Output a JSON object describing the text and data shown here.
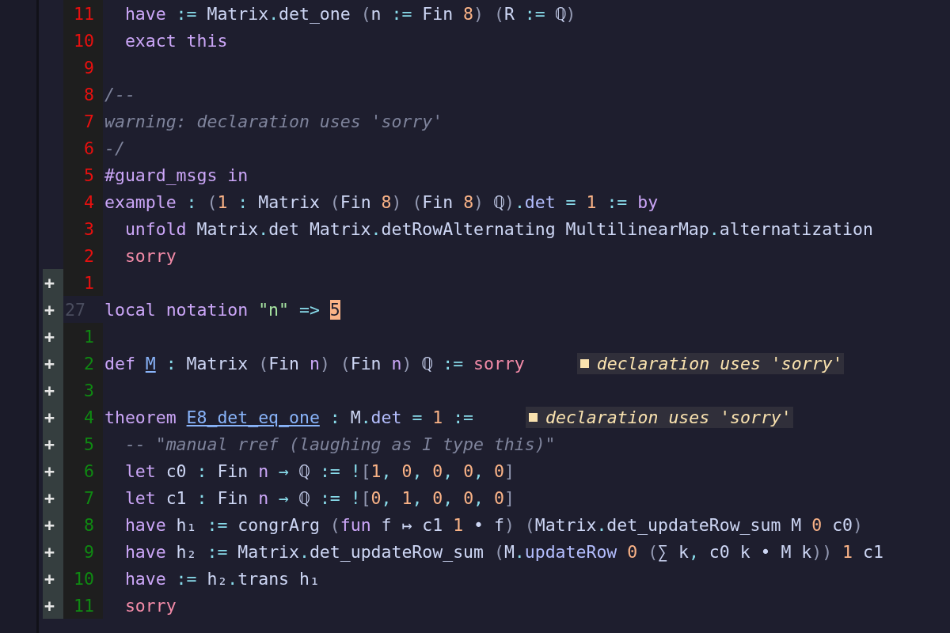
{
  "editor": {
    "lines": [
      {
        "number": "11",
        "kind": "above",
        "tokens": [
          {
            "text": "  have ",
            "kind": "kw"
          },
          {
            "text": ":= ",
            "kind": "op"
          },
          {
            "text": "Matrix",
            "kind": "id"
          },
          {
            "text": ".",
            "kind": "op"
          },
          {
            "text": "det_one ",
            "kind": "id"
          },
          {
            "text": "(",
            "kind": "paren"
          },
          {
            "text": "n ",
            "kind": "id"
          },
          {
            "text": ":= ",
            "kind": "op"
          },
          {
            "text": "Fin ",
            "kind": "id"
          },
          {
            "text": "8",
            "kind": "num"
          },
          {
            "text": ") (",
            "kind": "paren"
          },
          {
            "text": "R ",
            "kind": "id"
          },
          {
            "text": ":= ",
            "kind": "op"
          },
          {
            "text": "ℚ",
            "kind": "id"
          },
          {
            "text": ")",
            "kind": "paren"
          }
        ]
      },
      {
        "number": "10",
        "kind": "above",
        "tokens": [
          {
            "text": "  exact this",
            "kind": "kw"
          }
        ]
      },
      {
        "number": "9",
        "kind": "above"
      },
      {
        "number": "8",
        "kind": "above",
        "tokens": [
          {
            "text": "/--",
            "kind": "comment"
          }
        ]
      },
      {
        "number": "7",
        "kind": "above",
        "tokens": [
          {
            "text": "warning: declaration uses 'sorry'",
            "kind": "comment"
          }
        ]
      },
      {
        "number": "6",
        "kind": "above",
        "tokens": [
          {
            "text": "-/",
            "kind": "comment"
          }
        ]
      },
      {
        "number": "5",
        "kind": "above",
        "tokens": [
          {
            "text": "#guard_msgs in",
            "kind": "kw"
          }
        ]
      },
      {
        "number": "4",
        "kind": "above",
        "tokens": [
          {
            "text": "example",
            "kind": "kw"
          },
          {
            "text": " : ",
            "kind": "op"
          },
          {
            "text": "(",
            "kind": "paren"
          },
          {
            "text": "1",
            "kind": "num"
          },
          {
            "text": " : ",
            "kind": "op"
          },
          {
            "text": "Matrix ",
            "kind": "id"
          },
          {
            "text": "(",
            "kind": "paren"
          },
          {
            "text": "Fin ",
            "kind": "id"
          },
          {
            "text": "8",
            "kind": "num"
          },
          {
            "text": ") (",
            "kind": "paren"
          },
          {
            "text": "Fin ",
            "kind": "id"
          },
          {
            "text": "8",
            "kind": "num"
          },
          {
            "text": ")",
            "kind": "paren"
          },
          {
            "text": " ℚ",
            "kind": "id"
          },
          {
            "text": ")",
            "kind": "paren"
          },
          {
            "text": ".",
            "kind": "op"
          },
          {
            "text": "det",
            "kind": "field"
          },
          {
            "text": " = ",
            "kind": "op"
          },
          {
            "text": "1",
            "kind": "num"
          },
          {
            "text": " := ",
            "kind": "op"
          },
          {
            "text": "by",
            "kind": "kw"
          }
        ]
      },
      {
        "number": "3",
        "kind": "above",
        "tokens": [
          {
            "text": "  unfold",
            "kind": "kw"
          },
          {
            "text": " Matrix",
            "kind": "id"
          },
          {
            "text": ".",
            "kind": "op"
          },
          {
            "text": "det Matrix",
            "kind": "id"
          },
          {
            "text": ".",
            "kind": "op"
          },
          {
            "text": "detRowAlternating MultilinearMap",
            "kind": "id"
          },
          {
            "text": ".",
            "kind": "op"
          },
          {
            "text": "alternatization",
            "kind": "id"
          }
        ]
      },
      {
        "number": "2",
        "kind": "above",
        "tokens": [
          {
            "text": "  sorry",
            "kind": "sorry"
          }
        ]
      },
      {
        "number": "1",
        "kind": "above",
        "diff": "+"
      },
      {
        "number": "27",
        "kind": "current",
        "diff": "+",
        "tokens": [
          {
            "text": "local notation ",
            "kind": "kw"
          },
          {
            "text": "\"n\"",
            "kind": "str"
          },
          {
            "text": " => ",
            "kind": "op"
          },
          {
            "text": "5",
            "kind": "cursor"
          }
        ]
      },
      {
        "number": "1",
        "kind": "below",
        "diff": "+"
      },
      {
        "number": "2",
        "kind": "below",
        "diff": "+",
        "diagnostic": "declaration uses 'sorry'",
        "tokens": [
          {
            "text": "def ",
            "kind": "kw"
          },
          {
            "text": "M",
            "kind": "decl"
          },
          {
            "text": " : ",
            "kind": "op"
          },
          {
            "text": "Matrix ",
            "kind": "id"
          },
          {
            "text": "(",
            "kind": "paren"
          },
          {
            "text": "Fin ",
            "kind": "id"
          },
          {
            "text": "n",
            "kind": "var"
          },
          {
            "text": ") (",
            "kind": "paren"
          },
          {
            "text": "Fin ",
            "kind": "id"
          },
          {
            "text": "n",
            "kind": "var"
          },
          {
            "text": ")",
            "kind": "paren"
          },
          {
            "text": " ℚ",
            "kind": "id"
          },
          {
            "text": " := ",
            "kind": "op"
          },
          {
            "text": "sorry",
            "kind": "sorry"
          }
        ]
      },
      {
        "number": "3",
        "kind": "below",
        "diff": "+"
      },
      {
        "number": "4",
        "kind": "below",
        "diff": "+",
        "diagnostic": "declaration uses 'sorry'",
        "tokens": [
          {
            "text": "theorem ",
            "kind": "kw"
          },
          {
            "text": "E8_det_eq_one",
            "kind": "decl"
          },
          {
            "text": " : ",
            "kind": "op"
          },
          {
            "text": "M",
            "kind": "id"
          },
          {
            "text": ".",
            "kind": "op"
          },
          {
            "text": "det",
            "kind": "field"
          },
          {
            "text": " = ",
            "kind": "op"
          },
          {
            "text": "1",
            "kind": "num"
          },
          {
            "text": " :=",
            "kind": "op"
          }
        ]
      },
      {
        "number": "5",
        "kind": "below",
        "diff": "+",
        "tokens": [
          {
            "text": "  -- \"manual rref (laughing as I type this)\"",
            "kind": "comment"
          }
        ]
      },
      {
        "number": "6",
        "kind": "below",
        "diff": "+",
        "tokens": [
          {
            "text": "  let ",
            "kind": "kw"
          },
          {
            "text": "c0 ",
            "kind": "id"
          },
          {
            "text": ": ",
            "kind": "op"
          },
          {
            "text": "Fin ",
            "kind": "id"
          },
          {
            "text": "n",
            "kind": "var"
          },
          {
            "text": " → ",
            "kind": "op"
          },
          {
            "text": "ℚ ",
            "kind": "id"
          },
          {
            "text": ":= !",
            "kind": "op"
          },
          {
            "text": "[",
            "kind": "paren"
          },
          {
            "text": "1",
            "kind": "num"
          },
          {
            "text": ", ",
            "kind": "op"
          },
          {
            "text": "0",
            "kind": "num"
          },
          {
            "text": ", ",
            "kind": "op"
          },
          {
            "text": "0",
            "kind": "num"
          },
          {
            "text": ", ",
            "kind": "op"
          },
          {
            "text": "0",
            "kind": "num"
          },
          {
            "text": ", ",
            "kind": "op"
          },
          {
            "text": "0",
            "kind": "num"
          },
          {
            "text": "]",
            "kind": "paren"
          }
        ]
      },
      {
        "number": "7",
        "kind": "below",
        "diff": "+",
        "tokens": [
          {
            "text": "  let ",
            "kind": "kw"
          },
          {
            "text": "c1 ",
            "kind": "id"
          },
          {
            "text": ": ",
            "kind": "op"
          },
          {
            "text": "Fin ",
            "kind": "id"
          },
          {
            "text": "n",
            "kind": "var"
          },
          {
            "text": " → ",
            "kind": "op"
          },
          {
            "text": "ℚ ",
            "kind": "id"
          },
          {
            "text": ":= !",
            "kind": "op"
          },
          {
            "text": "[",
            "kind": "paren"
          },
          {
            "text": "0",
            "kind": "num"
          },
          {
            "text": ", ",
            "kind": "op"
          },
          {
            "text": "1",
            "kind": "num"
          },
          {
            "text": ", ",
            "kind": "op"
          },
          {
            "text": "0",
            "kind": "num"
          },
          {
            "text": ", ",
            "kind": "op"
          },
          {
            "text": "0",
            "kind": "num"
          },
          {
            "text": ", ",
            "kind": "op"
          },
          {
            "text": "0",
            "kind": "num"
          },
          {
            "text": "]",
            "kind": "paren"
          }
        ]
      },
      {
        "number": "8",
        "kind": "below",
        "diff": "+",
        "tokens": [
          {
            "text": "  have ",
            "kind": "kw"
          },
          {
            "text": "h₁ ",
            "kind": "id"
          },
          {
            "text": ":= ",
            "kind": "op"
          },
          {
            "text": "congrArg ",
            "kind": "id"
          },
          {
            "text": "(",
            "kind": "paren"
          },
          {
            "text": "fun ",
            "kind": "kw"
          },
          {
            "text": "f ↦ c1 ",
            "kind": "id"
          },
          {
            "text": "1",
            "kind": "num"
          },
          {
            "text": " • f",
            "kind": "id"
          },
          {
            "text": ") (",
            "kind": "paren"
          },
          {
            "text": "Matrix",
            "kind": "id"
          },
          {
            "text": ".",
            "kind": "op"
          },
          {
            "text": "det_updateRow_sum M ",
            "kind": "id"
          },
          {
            "text": "0",
            "kind": "num"
          },
          {
            "text": " c0",
            "kind": "id"
          },
          {
            "text": ")",
            "kind": "paren"
          }
        ]
      },
      {
        "number": "9",
        "kind": "below",
        "diff": "+",
        "tokens": [
          {
            "text": "  have ",
            "kind": "kw"
          },
          {
            "text": "h₂ ",
            "kind": "id"
          },
          {
            "text": ":= ",
            "kind": "op"
          },
          {
            "text": "Matrix",
            "kind": "id"
          },
          {
            "text": ".",
            "kind": "op"
          },
          {
            "text": "det_updateRow_sum ",
            "kind": "id"
          },
          {
            "text": "(",
            "kind": "paren"
          },
          {
            "text": "M",
            "kind": "id"
          },
          {
            "text": ".",
            "kind": "op"
          },
          {
            "text": "updateRow ",
            "kind": "field"
          },
          {
            "text": "0",
            "kind": "num"
          },
          {
            "text": " (",
            "kind": "paren"
          },
          {
            "text": "∑ k",
            "kind": "id"
          },
          {
            "text": ", ",
            "kind": "op"
          },
          {
            "text": "c0 k • M k",
            "kind": "id"
          },
          {
            "text": ")) ",
            "kind": "paren"
          },
          {
            "text": "1",
            "kind": "num"
          },
          {
            "text": " c1",
            "kind": "id"
          }
        ]
      },
      {
        "number": "10",
        "kind": "below",
        "diff": "+",
        "tokens": [
          {
            "text": "  have ",
            "kind": "kw"
          },
          {
            "text": ":= ",
            "kind": "op"
          },
          {
            "text": "h₂",
            "kind": "id"
          },
          {
            "text": ".",
            "kind": "op"
          },
          {
            "text": "trans h₁",
            "kind": "id"
          }
        ]
      },
      {
        "number": "11",
        "kind": "below",
        "diff": "+",
        "tokens": [
          {
            "text": "  sorry",
            "kind": "sorry"
          }
        ]
      }
    ]
  }
}
